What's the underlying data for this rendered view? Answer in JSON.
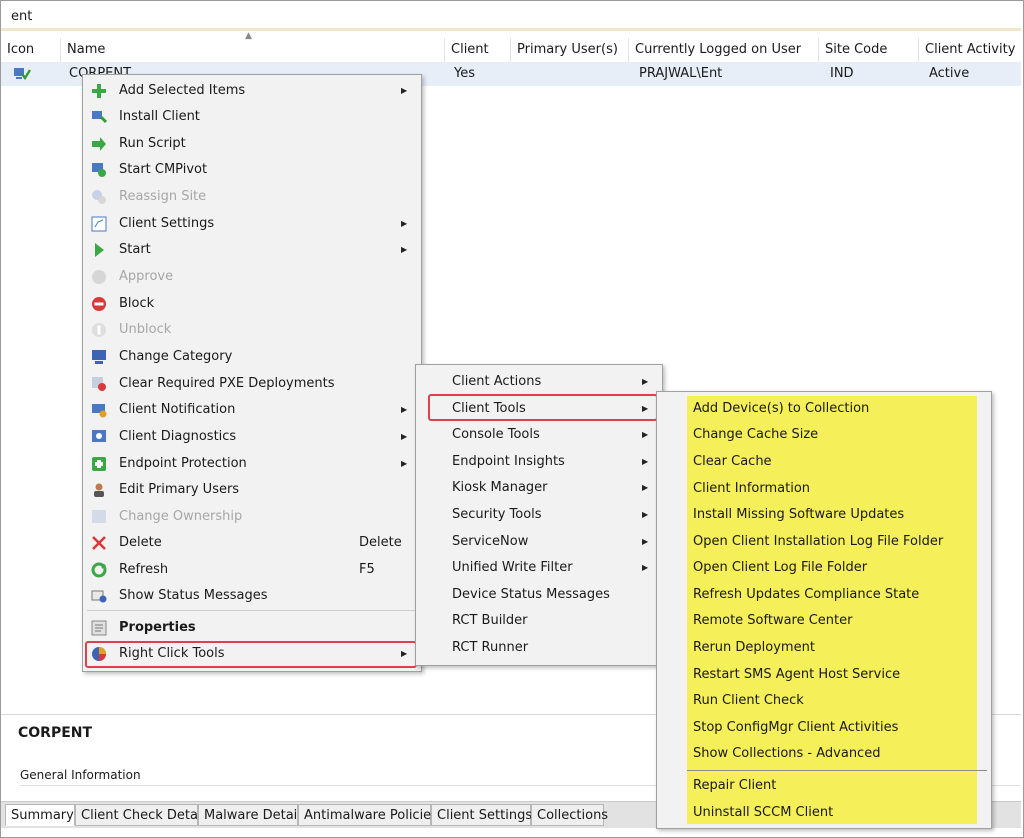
{
  "search": {
    "value": "ent"
  },
  "columns": [
    "Icon",
    "Name",
    "Client",
    "Primary User(s)",
    "Currently Logged on User",
    "Site Code",
    "Client Activity"
  ],
  "row": {
    "name": "CORPENT",
    "client": "Yes",
    "primary_user": "",
    "logged_on_user": "PRAJWAL\\Ent",
    "site_code": "IND",
    "client_activity": "Active"
  },
  "context_menu": {
    "items": [
      {
        "label": "Add Selected Items",
        "icon": "green-plus-icon",
        "submenu": true
      },
      {
        "label": "Install Client",
        "icon": "install-client-icon"
      },
      {
        "label": "Run Script",
        "icon": "green-arrow-icon"
      },
      {
        "label": "Start CMPivot",
        "icon": "cmpivot-icon"
      },
      {
        "label": "Reassign Site",
        "icon": "reassign-site-icon",
        "disabled": true
      },
      {
        "label": "Client Settings",
        "icon": "client-settings-icon",
        "submenu": true
      },
      {
        "label": "Start",
        "icon": "green-play-icon",
        "submenu": true
      },
      {
        "label": "Approve",
        "icon": "approve-icon",
        "disabled": true
      },
      {
        "label": "Block",
        "icon": "block-icon"
      },
      {
        "label": "Unblock",
        "icon": "unblock-icon",
        "disabled": true
      },
      {
        "label": "Change Category",
        "icon": "change-category-icon"
      },
      {
        "label": "Clear Required PXE Deployments",
        "icon": "pxe-icon"
      },
      {
        "label": "Client Notification",
        "icon": "client-notification-icon",
        "submenu": true
      },
      {
        "label": "Client Diagnostics",
        "icon": "client-diagnostics-icon",
        "submenu": true
      },
      {
        "label": "Endpoint Protection",
        "icon": "endpoint-protection-icon",
        "submenu": true
      },
      {
        "label": "Edit Primary Users",
        "icon": "user-icon"
      },
      {
        "label": "Change Ownership",
        "icon": "change-ownership-icon",
        "disabled": true
      },
      {
        "label": "Delete",
        "icon": "red-x-icon",
        "shortcut": "Delete"
      },
      {
        "label": "Refresh",
        "icon": "refresh-icon",
        "shortcut": "F5"
      },
      {
        "label": "Show Status Messages",
        "icon": "status-messages-icon"
      },
      {
        "label": "Properties",
        "icon": "properties-icon",
        "bold": true
      },
      {
        "label": "Right Click Tools",
        "icon": "right-click-tools-icon",
        "submenu": true,
        "highlighted": true
      }
    ]
  },
  "submenu_rct": {
    "items": [
      {
        "label": "Client Actions",
        "submenu": true
      },
      {
        "label": "Client Tools",
        "submenu": true,
        "highlighted": true
      },
      {
        "label": "Console Tools",
        "submenu": true
      },
      {
        "label": "Endpoint Insights",
        "submenu": true
      },
      {
        "label": "Kiosk Manager",
        "submenu": true
      },
      {
        "label": "Security Tools",
        "submenu": true
      },
      {
        "label": "ServiceNow",
        "submenu": true
      },
      {
        "label": "Unified Write Filter",
        "submenu": true
      },
      {
        "label": "Device Status Messages"
      },
      {
        "label": "RCT Builder"
      },
      {
        "label": "RCT Runner"
      }
    ]
  },
  "submenu_client_tools": {
    "items": [
      "Add Device(s) to Collection",
      "Change Cache Size",
      "Clear Cache",
      "Client Information",
      "Install Missing Software Updates",
      "Open Client Installation Log File Folder",
      "Open Client Log File Folder",
      "Refresh Updates Compliance State",
      "Remote Software Center",
      "Rerun Deployment",
      "Restart SMS Agent Host Service",
      "Run Client Check",
      "Stop ConfigMgr Client Activities",
      "Show Collections - Advanced",
      "Repair Client",
      "Uninstall SCCM Client"
    ],
    "highlight_color": "#f5ef59"
  },
  "details": {
    "title": "CORPENT",
    "section": "General Information"
  },
  "tabs": [
    "Summary",
    "Client Check Detail",
    "Malware Detail",
    "Antimalware Policies",
    "Client Settings",
    "Collections"
  ],
  "colors": {
    "selected_row": "#e7eef8",
    "menu_bg": "#f2f2f2",
    "highlight_border": "#d9444a",
    "yellow": "#f5ef59"
  }
}
